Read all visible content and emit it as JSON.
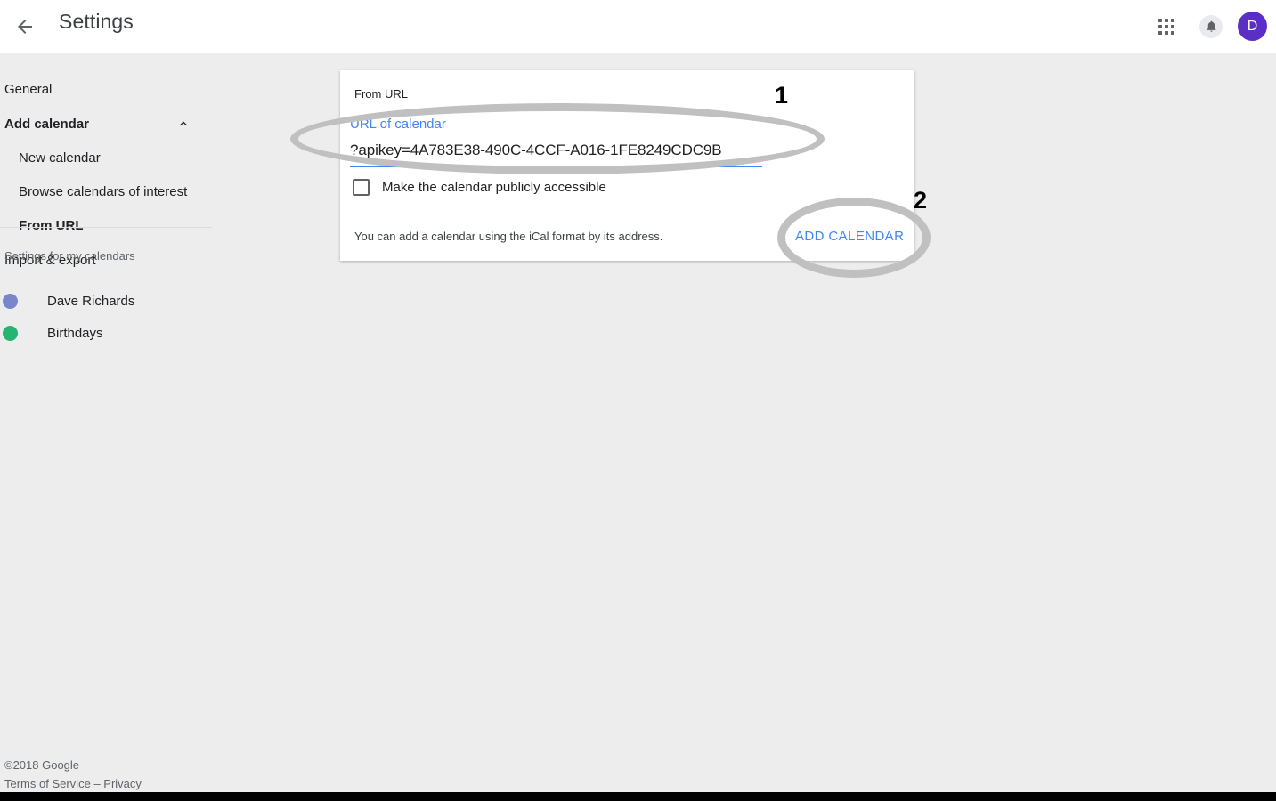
{
  "header": {
    "back_icon": "arrow-back-icon",
    "title": "Settings",
    "apps_icon": "apps-grid-icon",
    "notifications_icon": "bell-icon",
    "avatar_initial": "D"
  },
  "sidebar": {
    "items": [
      {
        "label": "General",
        "level": 0,
        "active": false
      },
      {
        "label": "Add calendar",
        "level": 0,
        "active": true,
        "expanded": true,
        "chevron": "chevron-up-icon"
      },
      {
        "label": "New calendar",
        "level": 1,
        "active": false
      },
      {
        "label": "Browse calendars of interest",
        "level": 1,
        "active": false
      },
      {
        "label": "From URL",
        "level": 1,
        "active": true
      },
      {
        "label": "Import & export",
        "level": 0,
        "active": false
      }
    ],
    "subhead": "Settings for my calendars",
    "calendars": [
      {
        "name": "Dave Richards",
        "color": "#7986cb"
      },
      {
        "name": "Birthdays",
        "color": "#26b473"
      }
    ]
  },
  "card": {
    "title": "From URL",
    "url_field": {
      "label": "URL of calendar",
      "value": "?apikey=4A783E38-490C-4CCF-A016-1FE8249CDC9B",
      "placeholder": "URL of calendar",
      "focused": true,
      "underline_color": "#4285f4"
    },
    "checkbox": {
      "label": "Make the calendar publicly accessible",
      "checked": false
    },
    "help_text": "You can add a calendar using the iCal format by its address.",
    "add_button_label": "ADD CALENDAR"
  },
  "annotations": [
    {
      "number": "1",
      "target": "url-of-calendar-field"
    },
    {
      "number": "2",
      "target": "add-calendar-button"
    }
  ],
  "footer": {
    "copyright": "©2018 Google",
    "terms": "Terms of Service",
    "separator": "–",
    "privacy": "Privacy"
  },
  "colors": {
    "accent": "#4285f4",
    "avatar": "#5b2ec4",
    "page_background": "#ededed",
    "annotation": "#c0c0c0"
  }
}
